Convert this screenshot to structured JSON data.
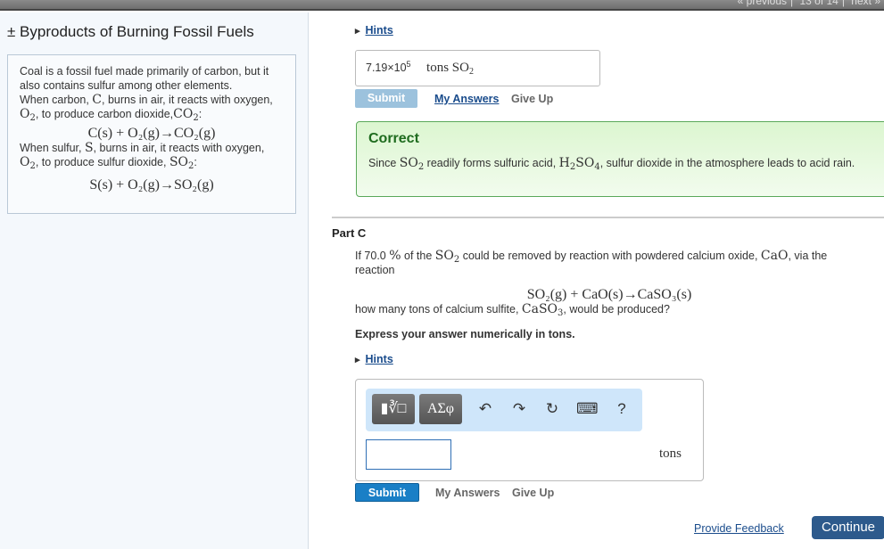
{
  "topnav": {
    "previous": "« previous",
    "position": "13 of 14",
    "next": "next »"
  },
  "sidebar": {
    "title": "± Byproducts of Burning Fossil Fuels",
    "intro": {
      "p1": "Coal is a fossil fuel made primarily of carbon, but it also contains sulfur among other elements.",
      "p2a": "When carbon, ",
      "p2_var": "C",
      "p2b": ", burns in air, it reacts with oxygen,",
      "p3_o2": "O",
      "p3_sub": "2",
      "p3a": ", to produce carbon dioxide,",
      "p3_co2": "CO",
      "p3_co2_sub": "2",
      "p3_colon": ":",
      "eq1": "C(s) + O₂(g)→CO₂(g)",
      "p4a": "When sulfur, ",
      "p4_var": "S",
      "p4b": ", burns in air, it reacts with oxygen,",
      "p5a": ", to produce sulfur dioxide, ",
      "p5_so2": "SO",
      "p5_sub": "2",
      "eq2": "S(s) + O₂(g)→SO₂(g)"
    }
  },
  "partB": {
    "hints_label": "Hints",
    "answer_mantissa": "7.19×10",
    "answer_exp": "5",
    "answer_unit": "tons SO",
    "answer_unit_sub": "2",
    "submit_label": "Submit",
    "my_answers_label": "My Answers",
    "give_up_label": "Give Up",
    "feedback": {
      "title": "Correct",
      "t1": "Since ",
      "so2": "SO",
      "so2_sub": "2",
      "t2": " readily forms sulfuric acid, ",
      "h2so4_h": "H",
      "h2so4_2": "2",
      "h2so4_so": "SO",
      "h2so4_4": "4",
      "t3": ", sulfur dioxide in the atmosphere leads to acid rain."
    }
  },
  "partC": {
    "title": "Part C",
    "q1": "If 70.0 ",
    "pct": "%",
    "q2": " of the ",
    "so2": "SO",
    "so2_sub": "2",
    "q3": " could be removed by reaction with powdered calcium oxide, ",
    "cao": "CaO",
    "q4": ", via the reaction",
    "equation": "SO₂(g) + CaO(s)→CaSO₃(s)",
    "q5": "how many tons of calcium sulfite, ",
    "caso3": "CaSO",
    "caso3_sub": "3",
    "q6": ", would be produced?",
    "instruction": "Express your answer numerically in tons.",
    "hints_label": "Hints",
    "toolbar": {
      "template_btn": "▮∛□",
      "greek_btn": "ΑΣφ",
      "undo": "↶",
      "redo": "↷",
      "reset": "↻",
      "keyboard": "⌨",
      "help": "?"
    },
    "answer_value": "",
    "unit": "tons",
    "submit_label": "Submit",
    "my_answers_label": "My Answers",
    "give_up_label": "Give Up"
  },
  "footer": {
    "feedback_label": "Provide Feedback",
    "continue_label": "Continue"
  }
}
